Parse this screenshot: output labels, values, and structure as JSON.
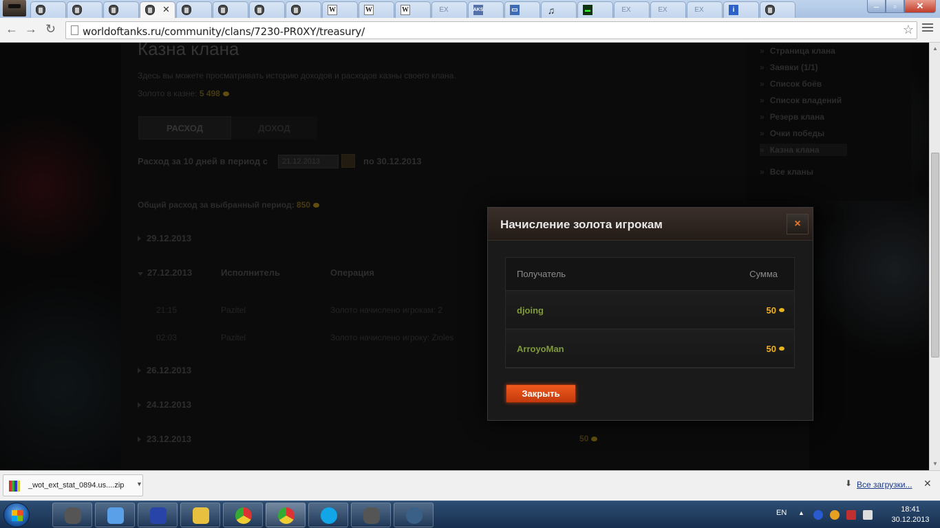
{
  "browser": {
    "url": "worldoftanks.ru/community/clans/7230-PR0XY/treasury/",
    "tabs": [
      {
        "icon": "wot-icon",
        "glyph": ""
      },
      {
        "icon": "wot-icon",
        "glyph": ""
      },
      {
        "icon": "wot-icon",
        "glyph": ""
      },
      {
        "icon": "wot-icon",
        "glyph": "",
        "active": true
      },
      {
        "icon": "wot-icon",
        "glyph": ""
      },
      {
        "icon": "wot-icon",
        "glyph": ""
      },
      {
        "icon": "wot-icon",
        "glyph": ""
      },
      {
        "icon": "wot-icon",
        "glyph": ""
      },
      {
        "icon": "wikipedia-icon",
        "glyph": "W"
      },
      {
        "icon": "wikipedia-icon",
        "glyph": "W"
      },
      {
        "icon": "wikipedia-icon",
        "glyph": "W"
      },
      {
        "icon": "ex-icon",
        "glyph": "EX"
      },
      {
        "icon": "aks-icon",
        "glyph": "AKS"
      },
      {
        "icon": "message-icon",
        "glyph": "▭"
      },
      {
        "icon": "music-note-icon",
        "glyph": "♫"
      },
      {
        "icon": "terminal-icon",
        "glyph": "▬"
      },
      {
        "icon": "ex-icon",
        "glyph": "EX"
      },
      {
        "icon": "ex-icon",
        "glyph": "EX"
      },
      {
        "icon": "ex-icon",
        "glyph": "EX"
      },
      {
        "icon": "info-icon",
        "glyph": "i"
      },
      {
        "icon": "wot-icon",
        "glyph": ""
      }
    ]
  },
  "page": {
    "title": "Казна клана",
    "description": "Здесь вы можете просматривать историю доходов и расходов казны своего клана.",
    "gold_label": "Золото в казне:",
    "gold_value": "5 498",
    "tab_expense": "РАСХОД",
    "tab_income": "ДОХОД",
    "period_label": "Расход за 10 дней в период с",
    "period_from": "21.12.2013",
    "period_to_label": "по 30.12.2013",
    "total_label": "Общий расход за выбранный период:",
    "total_value": "850",
    "dates": [
      "29.12.2013",
      "27.12.2013",
      "26.12.2013",
      "24.12.2013",
      "23.12.2013"
    ],
    "col_executor": "Исполнитель",
    "col_operation": "Операция",
    "rows": [
      {
        "time": "21:15",
        "executor": "Pazitel",
        "operation": "Золото начислено игрокам: 2"
      },
      {
        "time": "02:03",
        "executor": "Pazitel",
        "operation": "Золото начислено игроку: Zioles"
      }
    ],
    "amount_2312": "50"
  },
  "sidebar": {
    "items": [
      "Страница клана",
      "Заявки (1/1)",
      "Список боёв",
      "Список владений",
      "Резерв клана",
      "Очки победы",
      "Казна клана"
    ],
    "all_clans": "Все кланы"
  },
  "modal": {
    "title": "Начисление золота игрокам",
    "col_recipient": "Получатель",
    "col_sum": "Сумма",
    "rows": [
      {
        "name": "djoing",
        "sum": "50"
      },
      {
        "name": "ArroyoMan",
        "sum": "50"
      }
    ],
    "close_label": "Закрыть",
    "close_icon": "×"
  },
  "downloads": {
    "file": "_wot_ext_stat_0894.us....zip",
    "all_label": "Все загрузки..."
  },
  "taskbar": {
    "lang": "EN",
    "time": "18:41",
    "date": "30.12.2013"
  },
  "colors": {
    "accent_orange": "#e8521a",
    "gold": "#f0b020",
    "player_green": "#7f9a3a"
  }
}
